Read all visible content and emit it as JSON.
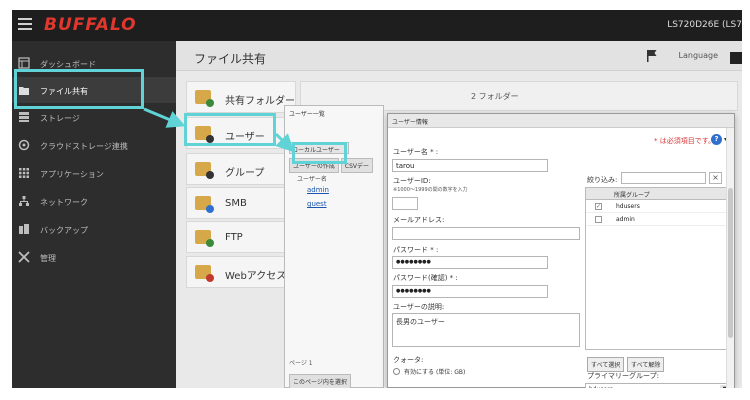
{
  "header": {
    "brand": "BUFFALO",
    "device": "LS720D26E (LS7"
  },
  "sidebar": {
    "items": [
      {
        "label": "ダッシュボード",
        "icon": "dashboard-icon"
      },
      {
        "label": "ファイル共有",
        "icon": "folder-icon"
      },
      {
        "label": "ストレージ",
        "icon": "storage-icon"
      },
      {
        "label": "クラウドストレージ連携",
        "icon": "cloud-icon"
      },
      {
        "label": "アプリケーション",
        "icon": "apps-icon"
      },
      {
        "label": "ネットワーク",
        "icon": "network-icon"
      },
      {
        "label": "バックアップ",
        "icon": "backup-icon"
      },
      {
        "label": "管理",
        "icon": "tools-icon"
      }
    ]
  },
  "main": {
    "title": "ファイル共有",
    "language": "Language",
    "cards": [
      {
        "label": "共有フォルダー"
      },
      {
        "label": "ユーザー"
      },
      {
        "label": "グループ"
      },
      {
        "label": "SMB"
      },
      {
        "label": "FTP"
      },
      {
        "label": "Webアクセス"
      }
    ],
    "bg_panel_text": "2 フォルダー"
  },
  "user_list": {
    "title": "ユーザー一覧",
    "tab": "ローカルユーザー",
    "create_button": "ユーザーの作成",
    "csv_button": "CSVデー",
    "column": "ユーザー名",
    "users": [
      "admin",
      "guest"
    ],
    "pager": "ページ 1",
    "select_page_button": "このページ内を選択"
  },
  "user_dialog": {
    "title": "ユーザー情報",
    "required_note": "* は必須項目です。",
    "username_label": "ユーザー名 * :",
    "username_value": "tarou",
    "userid_label": "ユーザーID:",
    "userid_note": "※1000〜1999の間の数字を入力",
    "userid_value": "",
    "email_label": "メールアドレス:",
    "email_value": "",
    "password_label": "パスワード * :",
    "password_value": "●●●●●●●●",
    "password_confirm_label": "パスワード(確認) * :",
    "password_confirm_value": "●●●●●●●●",
    "description_label": "ユーザーの説明:",
    "description_value": "長男のユーザー",
    "quota_label": "クォータ:",
    "quota_option": "有効にする (単位: GB)",
    "filter_label": "絞り込み:",
    "filter_value": "",
    "group_column": "所属グループ",
    "groups": [
      {
        "name": "hdusers",
        "checked": true
      },
      {
        "name": "admin",
        "checked": false
      }
    ],
    "select_all": "すべて選択",
    "deselect_all": "すべて解除",
    "primary_group_label": "プライマリーグループ:",
    "primary_group_value": "hdusers"
  },
  "colors": {
    "highlight": "#5fd3d6",
    "brand": "#e0382e",
    "sidebar_bg": "#2d2d2d"
  }
}
